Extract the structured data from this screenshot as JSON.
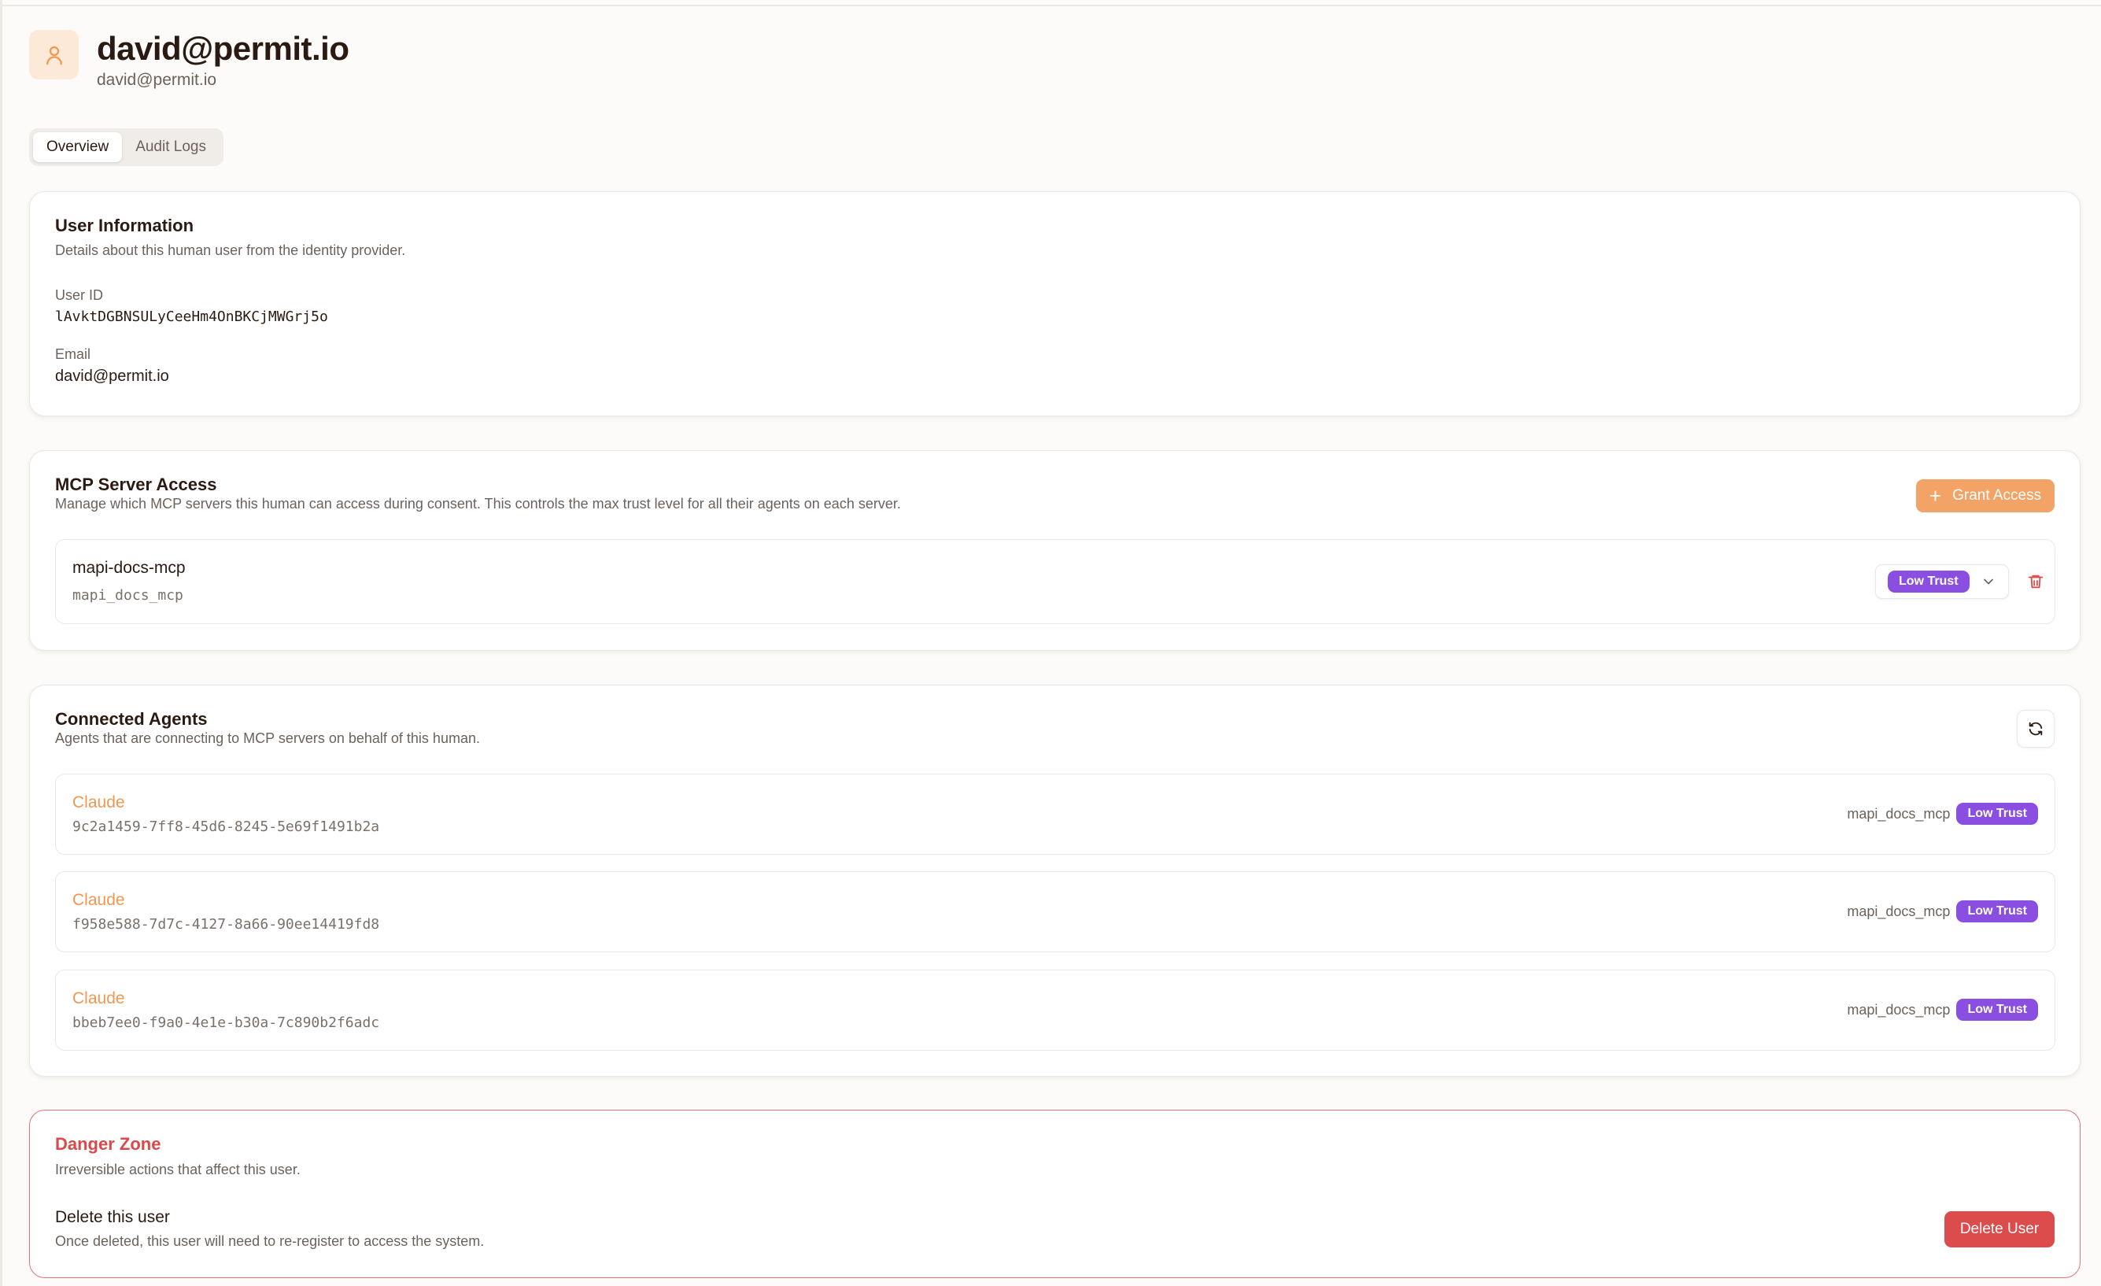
{
  "header": {
    "title": "david@permit.io",
    "subtitle": "david@permit.io",
    "avatar_icon": "user-icon"
  },
  "tabs": [
    {
      "label": "Overview",
      "active": true
    },
    {
      "label": "Audit Logs",
      "active": false
    }
  ],
  "user_info": {
    "title": "User Information",
    "description": "Details about this human user from the identity provider.",
    "user_id_label": "User ID",
    "user_id_value": "lAvktDGBNSULyCeeHm4OnBKCjMWGrj5o",
    "email_label": "Email",
    "email_value": "david@permit.io"
  },
  "mcp_access": {
    "title": "MCP Server Access",
    "description": "Manage which MCP servers this human can access during consent. This controls the max trust level for all their agents on each server.",
    "grant_button": "Grant Access",
    "servers": [
      {
        "name": "mapi-docs-mcp",
        "id": "mapi_docs_mcp",
        "trust": "Low Trust"
      }
    ]
  },
  "connected_agents": {
    "title": "Connected Agents",
    "description": "Agents that are connecting to MCP servers on behalf of this human.",
    "refresh_icon": "refresh-icon",
    "agents": [
      {
        "name": "Claude",
        "id": "9c2a1459-7ff8-45d6-8245-5e69f1491b2a",
        "server": "mapi_docs_mcp",
        "trust": "Low Trust"
      },
      {
        "name": "Claude",
        "id": "f958e588-7d7c-4127-8a66-90ee14419fd8",
        "server": "mapi_docs_mcp",
        "trust": "Low Trust"
      },
      {
        "name": "Claude",
        "id": "bbeb7ee0-f9a0-4e1e-b30a-7c890b2f6adc",
        "server": "mapi_docs_mcp",
        "trust": "Low Trust"
      }
    ]
  },
  "danger_zone": {
    "title": "Danger Zone",
    "description": "Irreversible actions that affect this user.",
    "action_title": "Delete this user",
    "action_description": "Once deleted, this user will need to re-register to access the system.",
    "delete_button": "Delete User"
  },
  "colors": {
    "accent": "#f2a365",
    "trust_badge": "#8a4fe0",
    "danger": "#dc4c4c"
  }
}
